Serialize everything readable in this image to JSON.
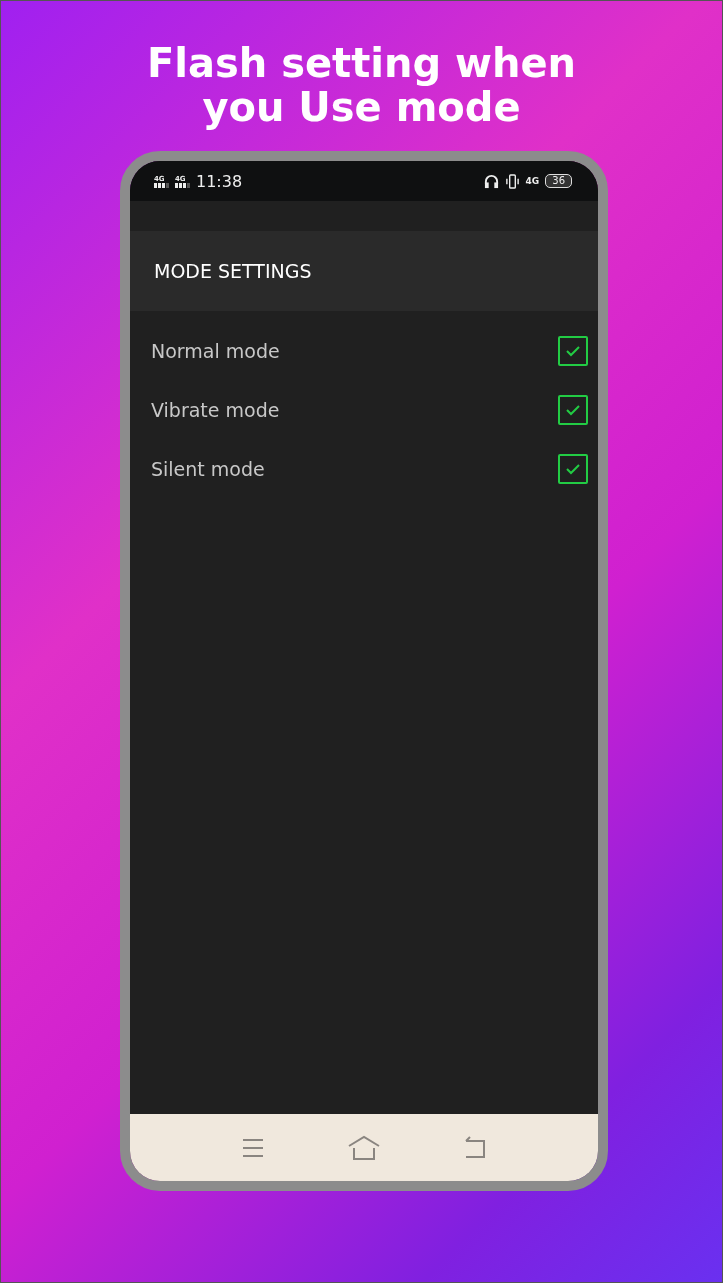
{
  "headline": "Flash setting when\nyou Use mode",
  "status_bar": {
    "sim_labels": [
      "4G",
      "4G"
    ],
    "time": "11:38",
    "data_label": "4G",
    "battery": "36"
  },
  "header": {
    "title": "MODE SETTINGS"
  },
  "modes": [
    {
      "label": "Normal mode",
      "checked": true
    },
    {
      "label": "Vibrate mode",
      "checked": true
    },
    {
      "label": "Silent mode",
      "checked": true
    }
  ]
}
